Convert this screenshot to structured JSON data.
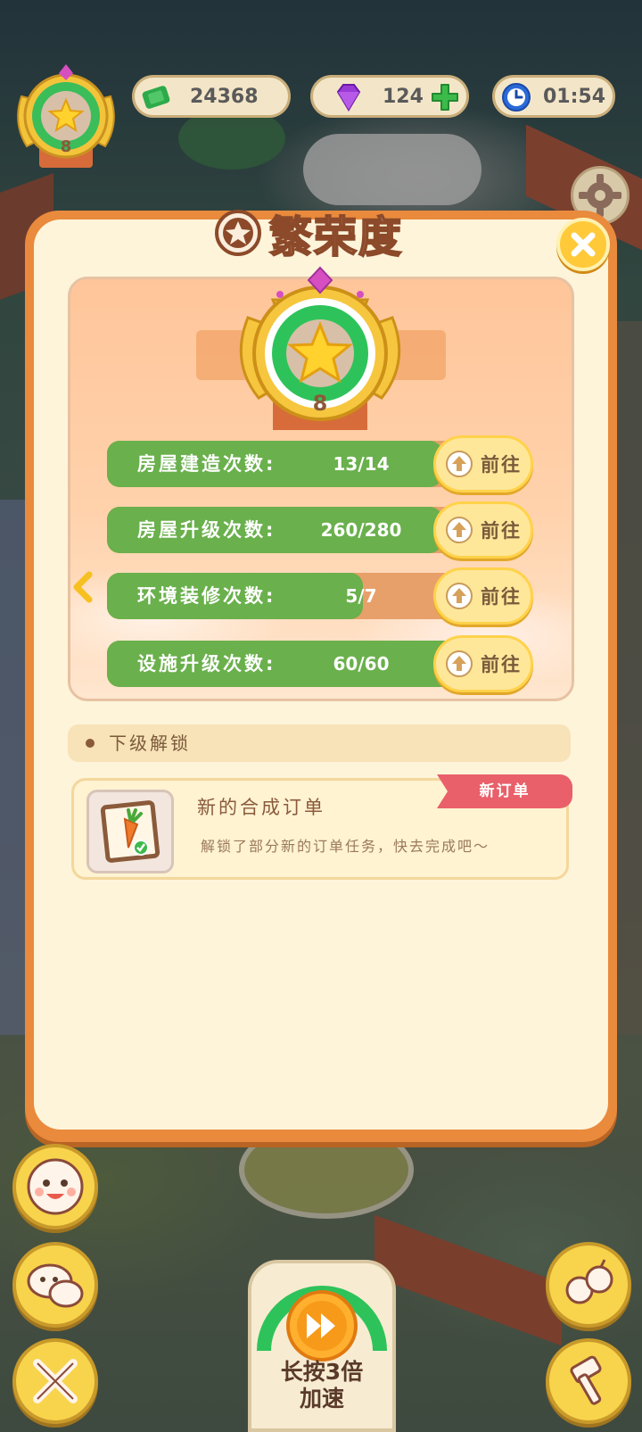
{
  "hud": {
    "level": "8",
    "cash": "24368",
    "gems": "124",
    "timer": "01:54"
  },
  "dialog": {
    "title": "繁荣度",
    "level": "8",
    "tasks": [
      {
        "label": "房屋建造次数:",
        "value": "13/14",
        "progress": 0.93,
        "button": "前往"
      },
      {
        "label": "房屋升级次数:",
        "value": "260/280",
        "progress": 0.93,
        "button": "前往"
      },
      {
        "label": "环境装修次数:",
        "value": "5/7",
        "progress": 0.71,
        "button": "前往"
      },
      {
        "label": "设施升级次数:",
        "value": "60/60",
        "progress": 1.0,
        "button": "前往"
      }
    ],
    "next_unlock_header": "下级解锁",
    "unlock": {
      "title": "新的合成订单",
      "description": "解锁了部分新的订单任务，快去完成吧～",
      "tag": "新订单"
    }
  },
  "bottom": {
    "speed_line1": "长按3倍",
    "speed_line2": "加速"
  },
  "colors": {
    "frame": "#e98a3c",
    "panel_bg": "#fdf4da",
    "bar_green": "#6ab04c",
    "button_yellow": "#ffe79a",
    "tag_red": "#e9606a"
  },
  "icons": [
    "cash-icon",
    "gem-icon",
    "plus-icon",
    "clock-icon",
    "gear-icon",
    "close-icon",
    "star-icon",
    "up-arrow-icon",
    "chevron-left-icon",
    "carrot-icon",
    "fast-forward-icon",
    "emoji-icon",
    "chat-icon",
    "tools-icon",
    "apple-icon",
    "hammer-icon"
  ]
}
